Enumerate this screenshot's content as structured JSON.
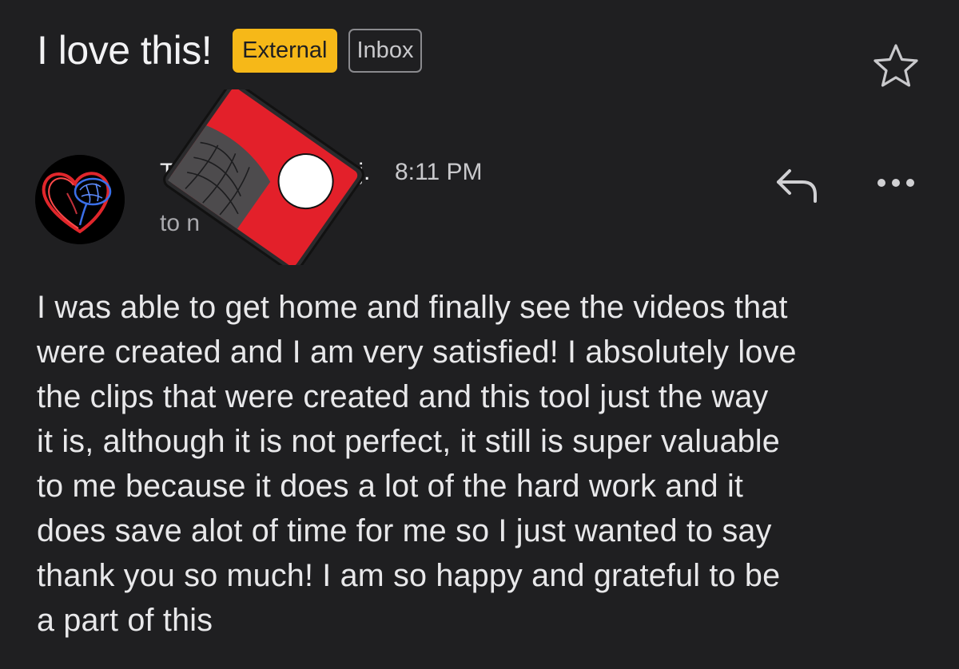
{
  "email": {
    "subject": "I love this!",
    "labels": {
      "external": "External",
      "inbox": "Inbox"
    },
    "sender": {
      "name_visible": "T",
      "name_suffix": "j.",
      "time": "8:11 PM",
      "to_line": "to n"
    },
    "body": "I was able to get home and finally see the videos that\nwere created and I am very satisfied! I absolutely love\nthe clips that were created and this tool just the way\nit is, although it is not perfect, it still is super valuable\nto me because it does a lot of the hard work and it\ndoes save alot of time for me so I just wanted to say\nthank you so much! I am so happy and grateful to be\na part of this"
  },
  "icons": {
    "star": "star-outline-icon",
    "reply": "reply-arrow-icon",
    "more": "more-horizontal-icon",
    "avatar": "heart-brain-avatar",
    "redaction": "redaction-sticker"
  },
  "colors": {
    "background": "#1f1f21",
    "external_label": "#f6b818",
    "inbox_border": "#8a8a8e",
    "text": "#e8e8ea",
    "muted": "#a9a9ad"
  }
}
